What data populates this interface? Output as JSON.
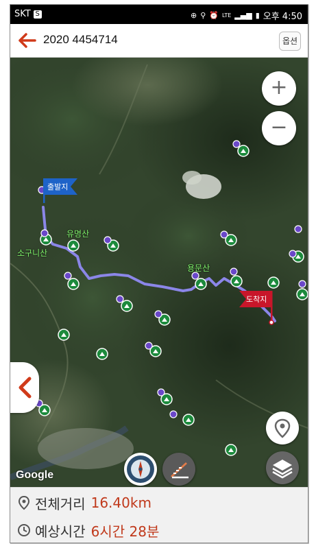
{
  "status_bar": {
    "carrier": "SKT",
    "carrier_badge": "S",
    "network": "LTE",
    "time": "오후 4:50",
    "icons": [
      "gps-icon",
      "location-icon",
      "alarm-icon",
      "signal-icon",
      "battery-icon"
    ]
  },
  "app_bar": {
    "title": "2020 4454714",
    "options_label": "옵션"
  },
  "map": {
    "start_flag_label": "출발지",
    "end_flag_label": "도착지",
    "place_labels": {
      "yumyeongsan": "유명산",
      "sogunisan": "소구니산",
      "yongmunsan": "용문산"
    },
    "zoom_in": "+",
    "zoom_out": "−",
    "attribution": "Google"
  },
  "summary": {
    "distance_label": "전체거리",
    "distance_value": "16.40km",
    "time_label": "예상시간",
    "time_value": "6시간 28분"
  },
  "colors": {
    "accent": "#d03a1a",
    "route": "#8b86e8",
    "start_flag": "#1e63c8",
    "end_flag": "#c8162a",
    "value_text": "#c0391b"
  }
}
